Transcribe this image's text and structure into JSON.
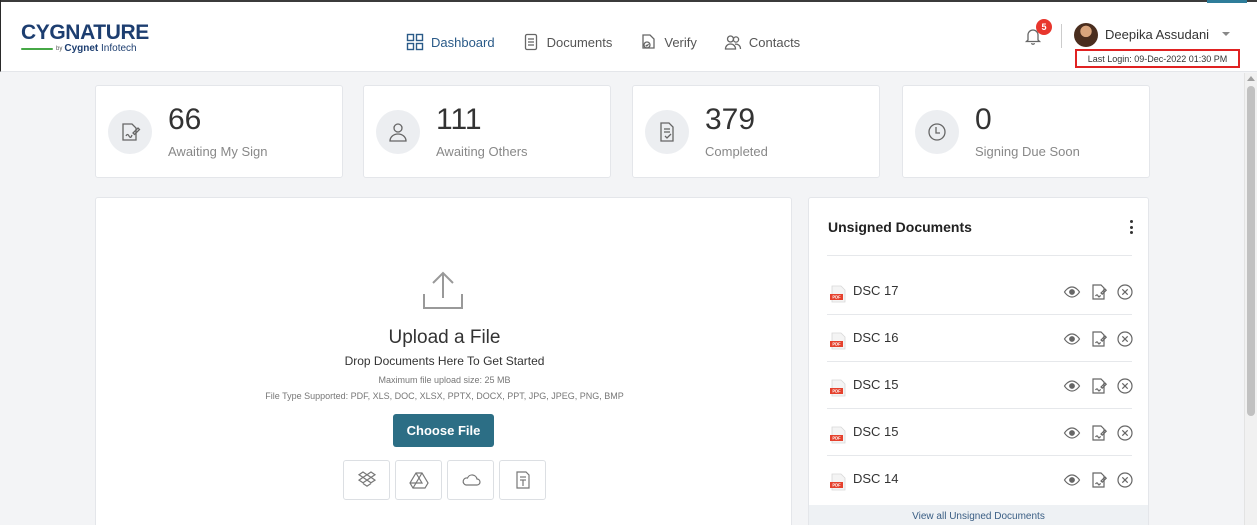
{
  "brand": {
    "name": "CYGNATURE",
    "by": "by",
    "company_bold": "Cygnet",
    "company_light": "Infotech"
  },
  "nav": [
    {
      "label": "Dashboard",
      "icon": "dashboard-grid-icon",
      "active": true
    },
    {
      "label": "Documents",
      "icon": "document-icon",
      "active": false
    },
    {
      "label": "Verify",
      "icon": "verify-icon",
      "active": false
    },
    {
      "label": "Contacts",
      "icon": "contacts-icon",
      "active": false
    }
  ],
  "header": {
    "notification_count": "5",
    "user_name": "Deepika Assudani",
    "last_login": "Last Login: 09-Dec-2022 01:30 PM"
  },
  "stats": [
    {
      "value": "66",
      "label": "Awaiting My Sign",
      "icon": "sign-pen-icon"
    },
    {
      "value": "111",
      "label": "Awaiting Others",
      "icon": "user-icon"
    },
    {
      "value": "379",
      "label": "Completed",
      "icon": "document-check-icon"
    },
    {
      "value": "0",
      "label": "Signing Due Soon",
      "icon": "clock-icon"
    }
  ],
  "upload": {
    "title": "Upload a File",
    "subtitle": "Drop Documents Here To Get Started",
    "max_size": "Maximum file upload size: 25 MB",
    "file_types": "File Type Supported: PDF, XLS, DOC, XLSX, PPTX, DOCX, PPT, JPG, JPEG, PNG, BMP",
    "button_label": "Choose File",
    "sources": [
      "dropbox-icon",
      "google-drive-icon",
      "onedrive-icon",
      "template-icon"
    ]
  },
  "unsigned": {
    "title": "Unsigned Documents",
    "file_badge": "PDF",
    "documents": [
      "DSC 17",
      "DSC 16",
      "DSC 15",
      "DSC 15",
      "DSC 14"
    ],
    "view_all": "View all Unsigned Documents"
  },
  "colors": {
    "brand": "#1d3e70",
    "accent": "#2c6e85",
    "badge": "#e8362d",
    "highlight_box": "#e02222",
    "pdf": "#e5412d"
  }
}
